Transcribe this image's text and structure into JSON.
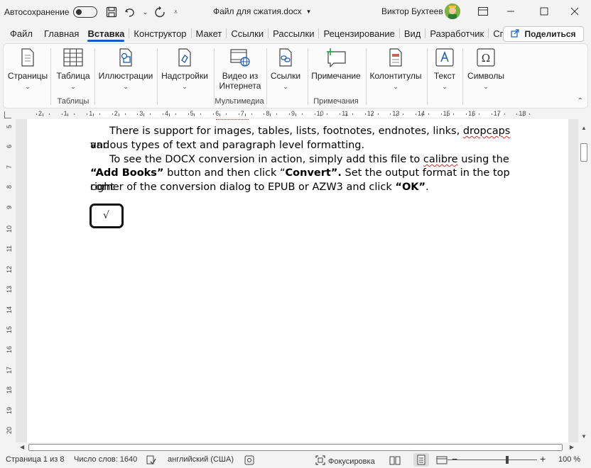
{
  "titlebar": {
    "autosave_label": "Автосохранение",
    "document_title": "Файл для сжатия.docx",
    "user_name": "Виктор Бухтеев"
  },
  "tabs": [
    {
      "label": "Файл"
    },
    {
      "label": "Главная"
    },
    {
      "label": "Вставка"
    },
    {
      "label": "Конструктор"
    },
    {
      "label": "Макет"
    },
    {
      "label": "Ссылки"
    },
    {
      "label": "Рассылки"
    },
    {
      "label": "Рецензирование"
    },
    {
      "label": "Вид"
    },
    {
      "label": "Разработчик"
    },
    {
      "label": "Справка"
    }
  ],
  "share_label": "Поделиться",
  "ribbon": {
    "pages": "Страницы",
    "table": "Таблица",
    "illustrations": "Иллюстрации",
    "addins": "Надстройки",
    "video_line1": "Видео из",
    "video_line2": "Интернета",
    "links": "Ссылки",
    "comment": "Примечание",
    "headers": "Колонтитулы",
    "text": "Текст",
    "symbols": "Символы",
    "group_tables": "Таблицы",
    "group_media": "Мультимедиа",
    "group_comments": "Примечания"
  },
  "ruler": {
    "h_ticks": [
      "2",
      "1",
      "1",
      "2",
      "3",
      "4",
      "5",
      "6",
      "7",
      "8",
      "9",
      "10",
      "11",
      "12",
      "13",
      "14",
      "15",
      "16",
      "17",
      "18"
    ],
    "v_ticks": [
      "5",
      "6",
      "7",
      "8",
      "9",
      "10",
      "11",
      "12",
      "13",
      "14",
      "15",
      "16",
      "17",
      "18",
      "19",
      "20"
    ]
  },
  "document": {
    "p1": {
      "text_a": "There is support for images, tables, lists, footnotes, endnotes, links, ",
      "squig_a": "dropcaps",
      "text_b": " and",
      "line2": "various types of text and paragraph level formatting."
    },
    "p2": {
      "a": "To see the DOCX conversion in action, simply add this file to ",
      "squig": "calibre",
      "b": " using the",
      "bold1": "“Add Books”",
      "c": " button and then click “",
      "bold2": "Convert”.",
      "d": "  Set the output format in the top right",
      "e": "corner of the conversion dialog to EPUB or AZW3 and click ",
      "bold3": "“OK”",
      "f": "."
    },
    "equation": "√"
  },
  "statusbar": {
    "page": "Страница 1 из 8",
    "words": "Число слов: 1640",
    "language": "английский (США)",
    "focus": "Фокусировка",
    "zoom": "100 %"
  }
}
